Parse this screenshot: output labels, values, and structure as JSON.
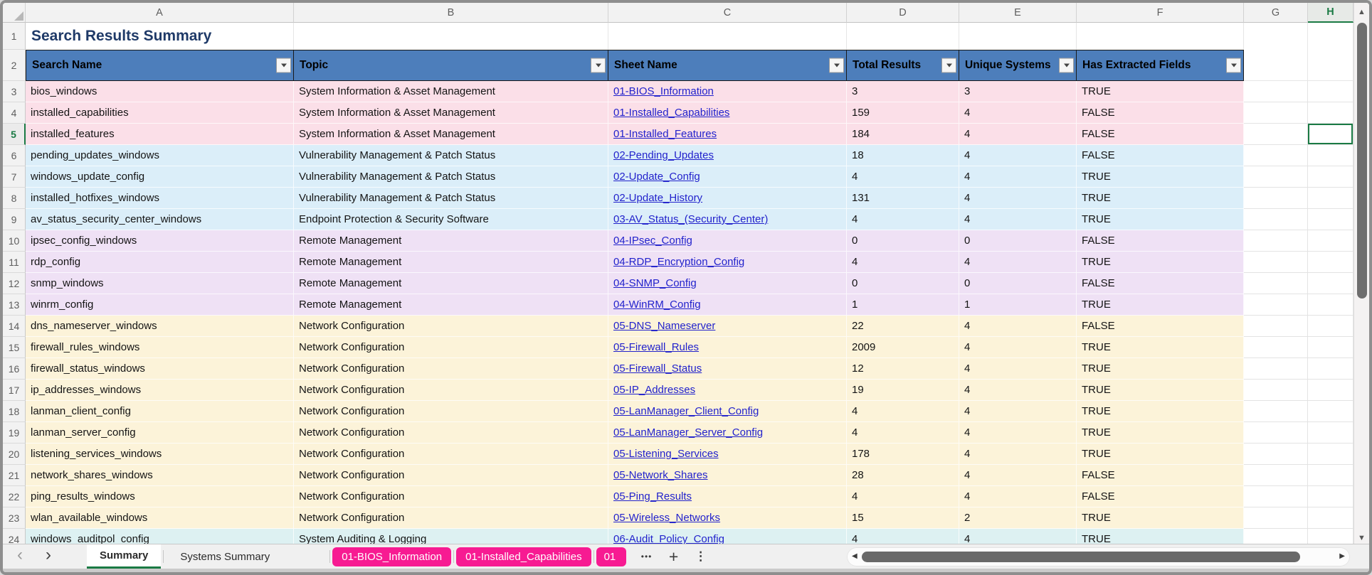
{
  "title": "Search Results Summary",
  "grid": {
    "column_letters": [
      "A",
      "B",
      "C",
      "D",
      "E",
      "F",
      "G",
      "H"
    ],
    "selected_column": "H",
    "selected_row": 5,
    "title_row_number": "1",
    "filter_row_number": "2"
  },
  "table": {
    "headers": [
      {
        "label": "Search Name"
      },
      {
        "label": "Topic"
      },
      {
        "label": "Sheet Name"
      },
      {
        "label": "Total Results"
      },
      {
        "label": "Unique Systems"
      },
      {
        "label": "Has Extracted Fields"
      }
    ],
    "rows": [
      {
        "num": 3,
        "search_name": "bios_windows",
        "topic": "System Information & Asset Management",
        "sheet_link": "01-BIOS_Information",
        "total_results": "3",
        "unique_systems": "3",
        "has_extracted_fields": "TRUE",
        "band": "pink"
      },
      {
        "num": 4,
        "search_name": "installed_capabilities",
        "topic": "System Information & Asset Management",
        "sheet_link": "01-Installed_Capabilities",
        "total_results": "159",
        "unique_systems": "4",
        "has_extracted_fields": "FALSE",
        "band": "pink"
      },
      {
        "num": 5,
        "search_name": "installed_features",
        "topic": "System Information & Asset Management",
        "sheet_link": "01-Installed_Features",
        "total_results": "184",
        "unique_systems": "4",
        "has_extracted_fields": "FALSE",
        "band": "pink"
      },
      {
        "num": 6,
        "search_name": "pending_updates_windows",
        "topic": "Vulnerability Management & Patch Status",
        "sheet_link": "02-Pending_Updates",
        "total_results": "18",
        "unique_systems": "4",
        "has_extracted_fields": "FALSE",
        "band": "blue"
      },
      {
        "num": 7,
        "search_name": "windows_update_config",
        "topic": "Vulnerability Management & Patch Status",
        "sheet_link": "02-Update_Config",
        "total_results": "4",
        "unique_systems": "4",
        "has_extracted_fields": "TRUE",
        "band": "blue"
      },
      {
        "num": 8,
        "search_name": "installed_hotfixes_windows",
        "topic": "Vulnerability Management & Patch Status",
        "sheet_link": "02-Update_History",
        "total_results": "131",
        "unique_systems": "4",
        "has_extracted_fields": "TRUE",
        "band": "blue"
      },
      {
        "num": 9,
        "search_name": "av_status_security_center_windows",
        "topic": "Endpoint Protection & Security Software",
        "sheet_link": "03-AV_Status_(Security_Center)",
        "total_results": "4",
        "unique_systems": "4",
        "has_extracted_fields": "TRUE",
        "band": "blue"
      },
      {
        "num": 10,
        "search_name": "ipsec_config_windows",
        "topic": "Remote Management",
        "sheet_link": "04-IPsec_Config",
        "total_results": "0",
        "unique_systems": "0",
        "has_extracted_fields": "FALSE",
        "band": "lavender"
      },
      {
        "num": 11,
        "search_name": "rdp_config",
        "topic": "Remote Management",
        "sheet_link": "04-RDP_Encryption_Config",
        "total_results": "4",
        "unique_systems": "4",
        "has_extracted_fields": "TRUE",
        "band": "lavender"
      },
      {
        "num": 12,
        "search_name": "snmp_windows",
        "topic": "Remote Management",
        "sheet_link": "04-SNMP_Config",
        "total_results": "0",
        "unique_systems": "0",
        "has_extracted_fields": "FALSE",
        "band": "lavender"
      },
      {
        "num": 13,
        "search_name": "winrm_config",
        "topic": "Remote Management",
        "sheet_link": "04-WinRM_Config",
        "total_results": "1",
        "unique_systems": "1",
        "has_extracted_fields": "TRUE",
        "band": "lavender"
      },
      {
        "num": 14,
        "search_name": "dns_nameserver_windows",
        "topic": "Network Configuration",
        "sheet_link": "05-DNS_Nameserver",
        "total_results": "22",
        "unique_systems": "4",
        "has_extracted_fields": "FALSE",
        "band": "yellow"
      },
      {
        "num": 15,
        "search_name": "firewall_rules_windows",
        "topic": "Network Configuration",
        "sheet_link": "05-Firewall_Rules",
        "total_results": "2009",
        "unique_systems": "4",
        "has_extracted_fields": "TRUE",
        "band": "yellow"
      },
      {
        "num": 16,
        "search_name": "firewall_status_windows",
        "topic": "Network Configuration",
        "sheet_link": "05-Firewall_Status",
        "total_results": "12",
        "unique_systems": "4",
        "has_extracted_fields": "TRUE",
        "band": "yellow"
      },
      {
        "num": 17,
        "search_name": "ip_addresses_windows",
        "topic": "Network Configuration",
        "sheet_link": "05-IP_Addresses",
        "total_results": "19",
        "unique_systems": "4",
        "has_extracted_fields": "TRUE",
        "band": "yellow"
      },
      {
        "num": 18,
        "search_name": "lanman_client_config",
        "topic": "Network Configuration",
        "sheet_link": "05-LanManager_Client_Config",
        "total_results": "4",
        "unique_systems": "4",
        "has_extracted_fields": "TRUE",
        "band": "yellow"
      },
      {
        "num": 19,
        "search_name": "lanman_server_config",
        "topic": "Network Configuration",
        "sheet_link": "05-LanManager_Server_Config",
        "total_results": "4",
        "unique_systems": "4",
        "has_extracted_fields": "TRUE",
        "band": "yellow"
      },
      {
        "num": 20,
        "search_name": "listening_services_windows",
        "topic": "Network Configuration",
        "sheet_link": "05-Listening_Services",
        "total_results": "178",
        "unique_systems": "4",
        "has_extracted_fields": "TRUE",
        "band": "yellow"
      },
      {
        "num": 21,
        "search_name": "network_shares_windows",
        "topic": "Network Configuration",
        "sheet_link": "05-Network_Shares",
        "total_results": "28",
        "unique_systems": "4",
        "has_extracted_fields": "FALSE",
        "band": "yellow"
      },
      {
        "num": 22,
        "search_name": "ping_results_windows",
        "topic": "Network Configuration",
        "sheet_link": "05-Ping_Results",
        "total_results": "4",
        "unique_systems": "4",
        "has_extracted_fields": "FALSE",
        "band": "yellow"
      },
      {
        "num": 23,
        "search_name": "wlan_available_windows",
        "topic": "Network Configuration",
        "sheet_link": "05-Wireless_Networks",
        "total_results": "15",
        "unique_systems": "2",
        "has_extracted_fields": "TRUE",
        "band": "yellow"
      },
      {
        "num": 24,
        "search_name": "windows_auditpol_config",
        "topic": "System Auditing & Logging",
        "sheet_link": "06-Audit_Policy_Config",
        "total_results": "4",
        "unique_systems": "4",
        "has_extracted_fields": "TRUE",
        "band": "cyan"
      }
    ]
  },
  "tabbar": {
    "prev_icon": "‹",
    "next_icon": "›",
    "tabs": [
      {
        "label": "Summary",
        "style": "active"
      },
      {
        "label": "Systems Summary",
        "style": "plain"
      },
      {
        "label": "01-BIOS_Information",
        "style": "pink"
      },
      {
        "label": "01-Installed_Capabilities",
        "style": "pink"
      },
      {
        "label": "01",
        "style": "pink-clipped"
      }
    ],
    "more_tabs_icon": "•••",
    "add_sheet_icon": "+",
    "menu_icon": "⋮"
  },
  "scrollbars": {
    "up_icon": "▲",
    "down_icon": "▼",
    "left_icon": "◀",
    "right_icon": "▶"
  },
  "colors": {
    "header_fill": "#4D7EBB",
    "band_pink": "#FBDFE8",
    "band_blue": "#DBEEF9",
    "band_lavender": "#EFE1F5",
    "band_yellow": "#FCF3D9",
    "band_cyan": "#DDF1F2",
    "hyperlink": "#2222CC",
    "title_text": "#1F3A68",
    "selection_green": "#1A7A44",
    "tab_pink": "#F71B92"
  }
}
